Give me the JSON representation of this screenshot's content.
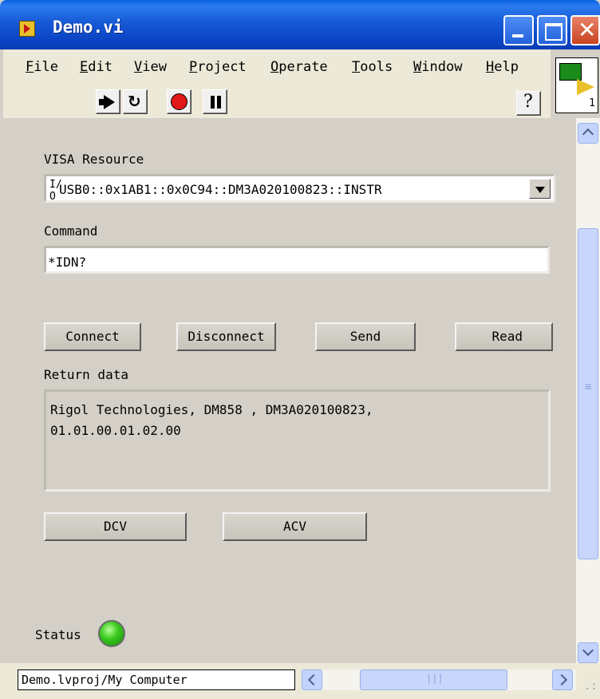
{
  "window": {
    "title": "Demo.vi"
  },
  "menu": {
    "items": [
      {
        "label": "File"
      },
      {
        "label": "Edit"
      },
      {
        "label": "View"
      },
      {
        "label": "Project"
      },
      {
        "label": "Operate"
      },
      {
        "label": "Tools"
      },
      {
        "label": "Window"
      },
      {
        "label": "Help"
      }
    ]
  },
  "toolbar": {
    "run_icon": "run-arrow-icon",
    "run_continuous_icon": "run-continuously-icon",
    "abort_icon": "abort-stop-icon",
    "pause_icon": "pause-icon",
    "help_icon": "context-help-icon",
    "help_glyph": "?"
  },
  "vi_icon": {
    "connector_number": "1"
  },
  "panel": {
    "visa_label": "VISA Resource",
    "visa_io_glyph": "I/O",
    "visa_value": "USB0::0x1AB1::0x0C94::DM3A020100823::INSTR",
    "command_label": "Command",
    "command_value": "*IDN?",
    "buttons": {
      "connect": "Connect",
      "disconnect": "Disconnect",
      "send": "Send",
      "read": "Read",
      "dcv": "DCV",
      "acv": "ACV"
    },
    "return_label": "Return data",
    "return_lines": [
      "Rigol Technologies, DM858 , DM3A020100823,",
      "01.01.00.01.02.00"
    ],
    "status_label": "Status",
    "status_led_color": "#3fcc20"
  },
  "statusbar": {
    "path": "Demo.lvproj/My Computer"
  },
  "colors": {
    "titlebar": "#0a44c4",
    "panel_bg": "#d4d0c8",
    "close_button": "#c9441f"
  }
}
